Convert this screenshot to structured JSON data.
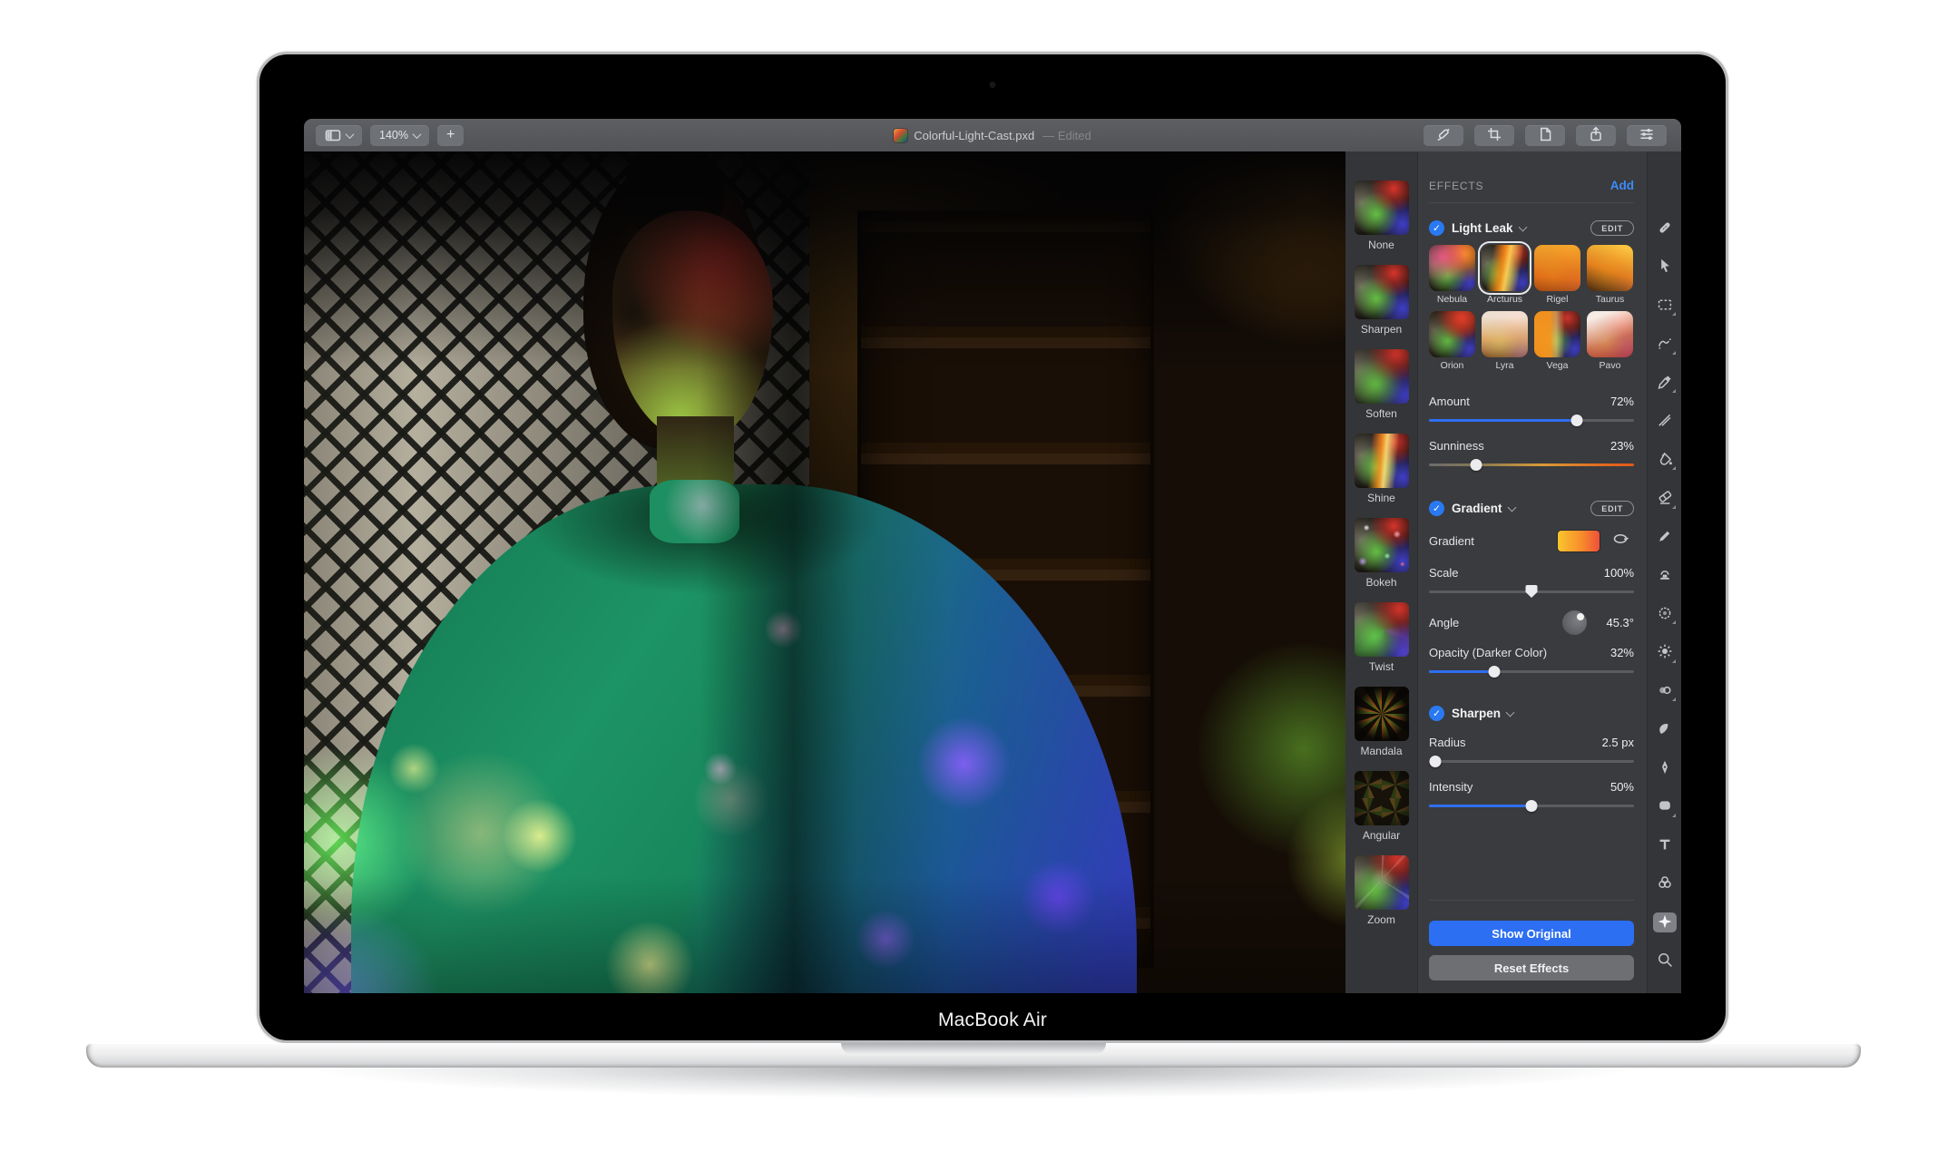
{
  "device": {
    "label": "MacBook Air"
  },
  "toolbar": {
    "zoom_level": "140%",
    "add_label": "+",
    "title": "Colorful-Light-Cast.pxd",
    "title_status": "— Edited",
    "left_icons": [
      "sidebar-view-icon",
      "chevron-down-icon",
      "plus-icon"
    ],
    "right_icons": [
      "annotate-icon",
      "crop-icon",
      "new-document-icon",
      "share-icon",
      "adjustments-icon"
    ]
  },
  "effects_browser": {
    "items": [
      "None",
      "Sharpen",
      "Soften",
      "Shine",
      "Bokeh",
      "Twist",
      "Mandala",
      "Angular",
      "Zoom"
    ]
  },
  "panel": {
    "header": "EFFECTS",
    "add_label": "Add",
    "light_leak": {
      "title": "Light Leak",
      "edit_label": "EDIT",
      "enabled": true,
      "presets": [
        "Nebula",
        "Arcturus",
        "Rigel",
        "Taurus",
        "Orion",
        "Lyra",
        "Vega",
        "Pavo"
      ],
      "selected_preset": "Arcturus",
      "amount": {
        "label": "Amount",
        "value": "72%",
        "percent": 72
      },
      "sunniness": {
        "label": "Sunniness",
        "value": "23%",
        "percent": 23
      }
    },
    "gradient": {
      "title": "Gradient",
      "edit_label": "EDIT",
      "enabled": true,
      "row_label": "Gradient",
      "swatch_colors": [
        "#f9c52e",
        "#f78f2a",
        "#ef4f3a"
      ],
      "scale": {
        "label": "Scale",
        "value": "100%",
        "percent": 50
      },
      "angle": {
        "label": "Angle",
        "value": "45.3°"
      },
      "opacity": {
        "label": "Opacity (Darker Color)",
        "value": "32%",
        "percent": 32
      }
    },
    "sharpen": {
      "title": "Sharpen",
      "enabled": true,
      "radius": {
        "label": "Radius",
        "value": "2.5 px",
        "percent": 3
      },
      "intensity": {
        "label": "Intensity",
        "value": "50%",
        "percent": 50
      }
    },
    "show_original_label": "Show Original",
    "reset_effects_label": "Reset Effects"
  },
  "tools": {
    "icons": [
      "repair-icon",
      "arrange-icon",
      "rect-select-icon",
      "quick-select-icon",
      "color-select-icon",
      "slice-icon",
      "fill-icon",
      "eraser-icon",
      "pencil-icon",
      "clone-icon",
      "soften-icon",
      "lighten-icon",
      "sponge-icon",
      "smudge-icon",
      "pen-icon",
      "shape-icon",
      "type-icon",
      "color-adjust-icon",
      "effects-icon",
      "zoom-tool-icon"
    ],
    "selected": "effects-icon"
  },
  "colors": {
    "accent_blue": "#2e6ff2",
    "link_blue": "#3d8bf8",
    "toolbar_bg": "#57595d",
    "panel_bg": "#3a3b3e",
    "show_original_bg": "#2d6ff2",
    "reset_bg": "#6e6f73",
    "sunniness_track": [
      "#6b6b6d",
      "#d89a38",
      "#e2581a"
    ]
  }
}
